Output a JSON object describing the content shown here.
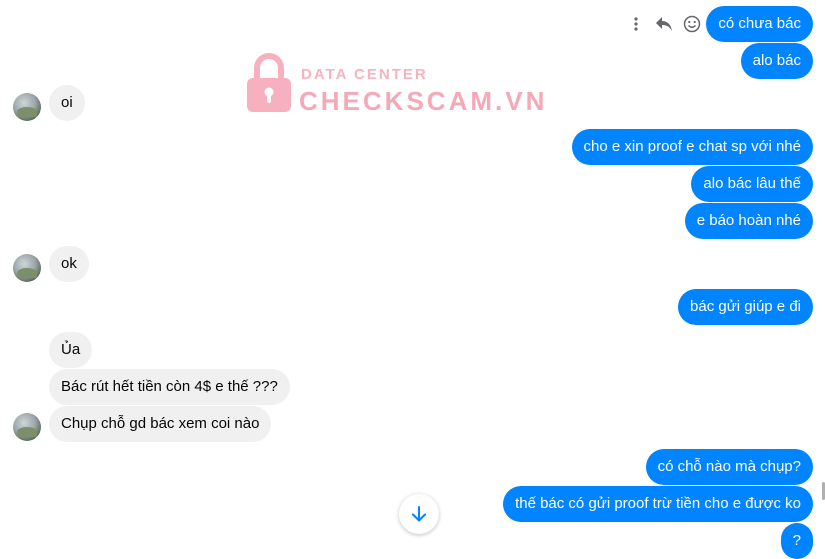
{
  "watermark": {
    "subtitle": "DATA CENTER",
    "title": "CHECKSCAM.VN"
  },
  "message_actions": {
    "icons": [
      "more-icon",
      "reply-icon",
      "react-icon"
    ]
  },
  "messages": [
    {
      "side": "out",
      "text": "có chưa bác"
    },
    {
      "side": "out",
      "text": "alo bác"
    },
    {
      "side": "in",
      "text": "oi"
    },
    {
      "side": "out",
      "text": "cho e xin proof e chat sp với nhé"
    },
    {
      "side": "out",
      "text": "alo bác lâu thế"
    },
    {
      "side": "out",
      "text": "e báo hoàn nhé"
    },
    {
      "side": "in",
      "text": "ok"
    },
    {
      "side": "out",
      "text": "bác gửi giúp e đi"
    },
    {
      "side": "in",
      "text": "Ủa"
    },
    {
      "side": "in",
      "text": "Bác rút hết tiền còn 4$ e thế ???"
    },
    {
      "side": "in",
      "text": "Chụp chỗ gd bác xem coi nào"
    },
    {
      "side": "out",
      "text": "có chỗ nào mà chụp?"
    },
    {
      "side": "out",
      "text": "thế bác có gửi proof trừ tiền cho e được ko"
    },
    {
      "side": "out",
      "text": "?"
    }
  ],
  "colors": {
    "outgoing": "#0084ff",
    "incoming": "#f0f0f0",
    "watermark": "#f5a9b8"
  }
}
